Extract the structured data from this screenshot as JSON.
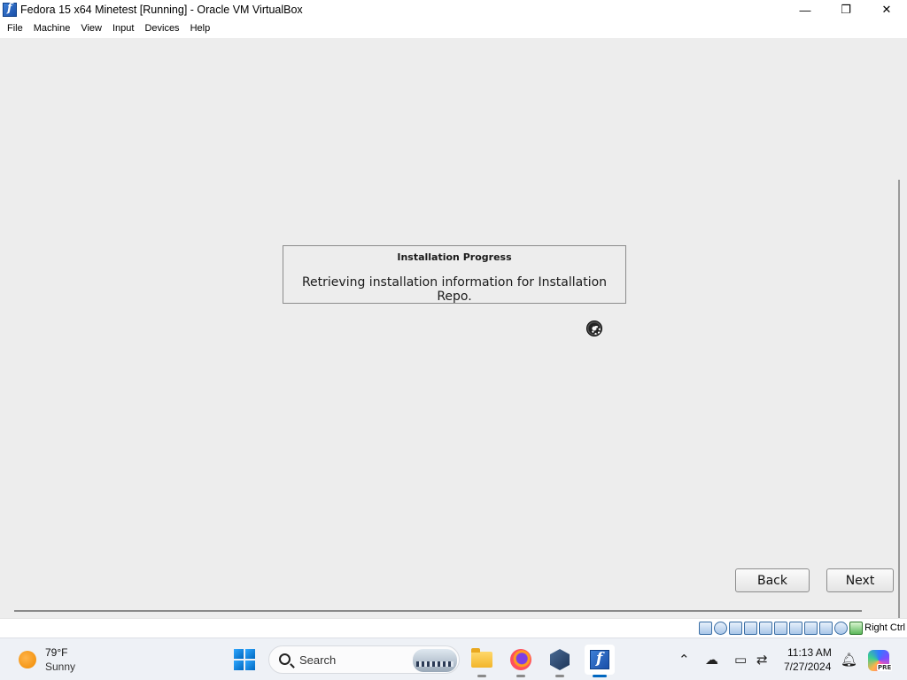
{
  "window": {
    "title": "Fedora 15 x64 Minetest [Running] - Oracle VM VirtualBox",
    "minimize_glyph": "—",
    "maximize_glyph": "❐",
    "close_glyph": "✕"
  },
  "menu": {
    "items": [
      "File",
      "Machine",
      "View",
      "Input",
      "Devices",
      "Help"
    ]
  },
  "vm": {
    "dialog": {
      "title": "Installation Progress",
      "message": "Retrieving installation information for Installation Repo."
    },
    "buttons": {
      "back": "Back",
      "next": "Next"
    }
  },
  "statusbar": {
    "icons": [
      "hard-disk-icon",
      "optical-drive-icon",
      "audio-icon",
      "network-icon",
      "usb-icon",
      "shared-folders-icon",
      "display-icon",
      "recording-icon",
      "vt-x-icon",
      "mouse-integration-icon",
      "keyboard-icon"
    ],
    "host_key": "Right Ctrl"
  },
  "taskbar": {
    "weather": {
      "temp": "79°F",
      "condition": "Sunny"
    },
    "search_placeholder": "Search",
    "clock": {
      "time": "11:13 AM",
      "date": "7/27/2024"
    },
    "copilot_badge": "PRE"
  }
}
